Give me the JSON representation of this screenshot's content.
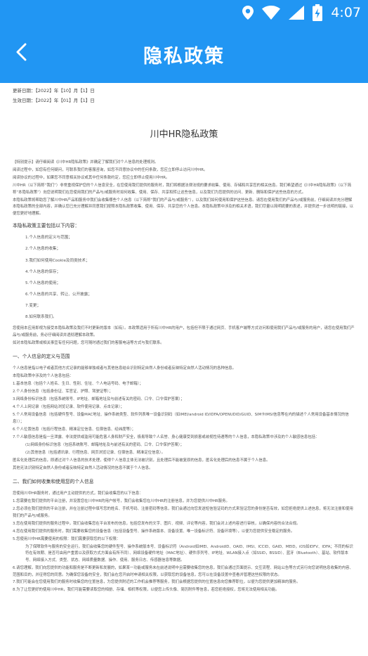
{
  "status_bar": {
    "time": "4:07",
    "icons": [
      "location-icon",
      "wifi-icon",
      "signal-icon",
      "battery-charging-icon"
    ]
  },
  "app_bar": {
    "title": "隐私政策",
    "back_icon": "back-arrow-icon"
  },
  "document": {
    "updated": "更新日期：【2022】年【10】月【1】日",
    "effective": "生效日期：【2022】年【01】月【1】日",
    "title": "川中HR隐私政策",
    "intro": [
      "【特别提示】请仔细阅读《川中HR隐私政策》并确定了解我们对个人信息的处理规则。",
      "阅读过程中，如您有任何疑问，可联系我们的客服咨询，如您不同意协议中的任何条款，您应立即停止访问川中HR。",
      "阅读协议的过程中，如果您不同意相关协议或其中任何条款约定，您应立即停止使用川中HR。",
      "川中HR（以下简称“我们”）非常重视保护您的个人信息安全，在您使用我们提供的服务时，我们将根据法律法规的要求收集、使用、存储和共享您的相关信息。我们希望通过《川中HR隐私政策》（以下简称“本隐私政策”）向您说明我们在您使用我们的产品与/或服务时如何收集、使用、保存、共享和转让这些信息，以及我们为您提供的访问、更新、删除和保护这些信息的方式。",
      "本隐私政策将帮助您了解川中HR产品和服务中我们会收集哪些个人信息（以下简称“我们的产品与/或服务”），以及我们如何使用和保护这些信息。请您在使用我们的产品与/或服务前，仔细阅读并充分理解本隐私政策的全部内容，并确认您已充分理解并同意我们按照本隐私政策收集、使用、保存、共享您的个人信息。本隐私政策中涉及的相关术语，我们尽量以简明扼要的表述，并提供进一步说明的链接，以便您更好地理解。"
    ],
    "toc_heading": "本隐私政策主要包括以下内容：",
    "toc": [
      "1.个人信息的定义与范围；",
      "2.个人信息的收集；",
      "3.我们如何使用Cookie及同类技术；",
      "4.个人信息的保存；",
      "5.个人信息的使用；",
      "6.个人信息的共享、转让、公开披露；",
      "7.变更；",
      "8.如何联系我们。"
    ],
    "after_toc": [
      "您使用本应用即视为接受本隐私政策及我们不时更新的版本（如有）。本政策适用于所有川中HR的用户，包括但不限于通过网页、手机客户端等方式访问和使用我们产品与/或服务的用户，请您在使用我们产品与/或服务前，务必仔细阅读并透彻理解本政策。",
      "如对本隐私政策或相关事宜有任何问题，您可随时通过我们的客服电话等方式与我们联系。"
    ],
    "section1_heading": "一、个人信息的定义与范围",
    "section1": [
      "个人信息是指以电子或者其他方式记录的能够单独或者与其他信息结合识别特定自然人身份或者反映特定自然人活动情况的各种信息。",
      "本隐私政策中涉及的个人信息包括：",
      "1.基本信息（包括个人姓名、生日、性别、住址、个人电话号码、电子邮箱）；",
      "2.个人身份信息（包括身份证、军官证、护照、驾驶证等）；",
      "3.网络身份标识信息（包括系统账号、IP地址、邮箱地址及与前述有关的密码、口令、口令保护答案）；",
      "4.个人上网记录（包括网站浏览记录、软件使用记录、点击记录）；",
      "5.个人常用设备信息（包括硬件型号、设备MAC地址、操作系统类型、软件列表唯一设备识别码（如IMEI/android ID/IDFA/OPENUDID/GUID、SIM卡IMSI信息等在内的描述个人常用设备基本情况的信息））；",
      "6.个人位置信息（包括行程信息、精准定位信息、住宿信息、经纬度等）；",
      "7.个人敏感信息是指一旦泄露、非法提供或滥用可能危害人身和财产安全，极易导致个人名誉、身心健康受到损害或歧视性待遇等的个人信息，本隐私政策中涉及的个人敏感信息包括：",
      "(1)网络身份标识信息（包括系统账号、邮箱地址及与前述有关的密码、口令、口令保护答案）；",
      "(2)其他信息（包括通讯录、行程信息、网页浏览记录、住宿信息、精准定位信息）。",
      "匿名化处理后的信息，即通过对个人信息的技术处理，使得个人信息主体无法被识别，且处理后不能被复原的信息，匿名化处理后的信息不属于个人信息。",
      "其他无法识别特定自然人身份或者反映特定自然人活动情况的信息不属于个人信息。"
    ],
    "section2_heading": "二、我们如何收集和使用您的个人信息",
    "section2": [
      "您使用川中HR服务时，通过用户主动提供的方式，我们会收集您的以下信息：",
      "1.您需要在我们提供的平台注册，并设置您在川中HR的用户帐号，我们会收集您在川中HR的注册信息，并为您提供川中HR服务。",
      "2.您必须在我们提供的平台注册，并在注册过程中填写您的姓名、手机号码、注册密码等信息，我们会通过向您发送短信验证码的方式来验证您的身份是否有效，如您拒绝提供上述信息，将无法注册和使用我们的产品与/或服务。",
      "3.您在使用我们提供的服务过程中，我们会收集您在平台发布的信息，包括您发布的文字、图片、视频、评论等内容，我们会对上述内容进行审核，以确保内容的合法合规。",
      "4.您在使用我们提供的服务时，我们需要收集您的设备信息（包括设备型号、操作系统版本、设备设置、唯一设备标识符、设备环境等），以便为您提供安全稳定的服务。",
      "5.您使用川中HR需要使用的权限：我们需要获取您的以下权限：",
      "为了保障软件与服务的安全运行，我们会收集您的硬件型号、操作系统版本号、设备标识符（Android如IMEI、AndroidID、OAID、IMSI、ICCID、GAID、MEID，iOS如IDFV、IDFA；不同的标识符在有效期、是否可由用户重置以及获取方式方面会有所不同）、网络设备硬件地址（MAC地址）、硬件序列号、IP地址、WLAN接入点（如SSID，BSSID）、蓝牙（Bluetooth）、基站、软件版本号、网络接入方式、类型、状态、网络质量数据、操作、使用、服务日志、传感器信息等数据。",
      "6.请您理解，我们向您提供的功能和服务是不断更新和发展的，如果某一功能或服务未在前述说明中且需要收集您的信息，我们会通过页面提示、交互流程、网站公告等方式另行向您说明信息收集的内容、范围和目的，并征得您的同意。为确保您设备的安全，我们会在您开启时申请相关权限，以获取您的设备信息，您可以在设备设置中查看并管理这些权限的状态。",
      "7.我们可能会在您使用我们的服务时收集您的位置信息，为您提供附近的工作机会推荐等服务，我们会根据您提供的位置信息向您推荐职位，以便为您提供更加精准的服务。",
      "8.为了让您更好的使用川中HR，我们可能需要读取您的相册、存储、相机等权限，以便您上传头像、简历附件等信息，若您拒绝授权，您将无法使用相关功能。"
    ]
  }
}
